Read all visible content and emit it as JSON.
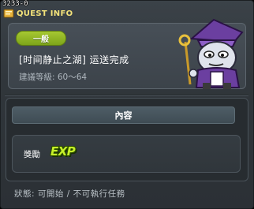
{
  "window": {
    "quest_id": "3233-0",
    "title": "QUEST INFO"
  },
  "quest": {
    "badge": "一般",
    "name": "[时间静止之湖] 运送完成",
    "level_requirement": "建議等級: 60～64"
  },
  "content": {
    "header": "內容",
    "reward_label": "獎勵",
    "reward_item": "EXP"
  },
  "status": "狀態: 可開始 / 不可執行任務",
  "colors": {
    "title": "#f3e27a",
    "badge": "#8fb526",
    "exp": "#c6f02a"
  }
}
